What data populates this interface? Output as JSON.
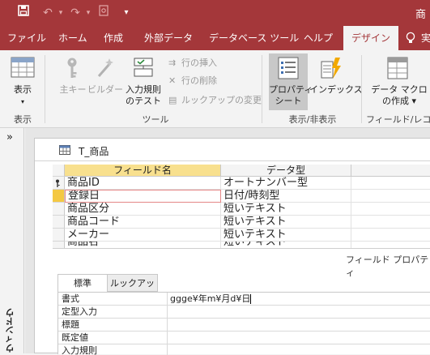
{
  "title_bar": {
    "save_icon": "save-icon",
    "undo_icon": "undo-icon",
    "redo_icon": "redo-icon",
    "print_preview_icon": "print-preview-icon",
    "customize_icon": "customize-qat-icon",
    "title_fragment": "商"
  },
  "tabs": [
    "ファイル",
    "ホーム",
    "作成",
    "外部データ",
    "データベース ツール",
    "ヘルプ",
    "デザイン"
  ],
  "ribbon": {
    "view": {
      "label": "表示",
      "group": "表示"
    },
    "tools": {
      "primary_key": "主キー",
      "builder": "ビルダー",
      "test_rules": [
        "入力規則",
        "のテスト"
      ],
      "insert_rows": "行の挿入",
      "delete_rows": "行の削除",
      "modify_lookups": "ルックアップの変更",
      "group": "ツール"
    },
    "show_hide": {
      "property_sheet": [
        "プロパティ",
        "シート"
      ],
      "indexes": "インデックス",
      "group": "表示/非表示"
    },
    "field_record": {
      "data_macros": [
        "データ マクロ",
        "の作成"
      ],
      "group": "フィールド/レコード"
    }
  },
  "nav_pane": {
    "expand": "»",
    "title": "ウィンドウ"
  },
  "table": {
    "name": "T_商品",
    "columns": [
      "フィールド名",
      "データ型"
    ],
    "rows": [
      {
        "field": "商品ID",
        "type": "オートナンバー型",
        "primary_key": true
      },
      {
        "field": "登録日",
        "type": "日付/時刻型",
        "selected": true
      },
      {
        "field": "商品区分",
        "type": "短いテキスト"
      },
      {
        "field": "商品コード",
        "type": "短いテキスト"
      },
      {
        "field": "メーカー",
        "type": "短いテキスト"
      },
      {
        "field": "商品名",
        "type": "短いテキスト"
      }
    ]
  },
  "field_properties": {
    "heading": "フィールド プロパティ",
    "tabs": [
      "標準",
      "ルックアップ"
    ],
    "rows": [
      {
        "label": "書式",
        "value": "ggge¥年m¥月d¥日"
      },
      {
        "label": "定型入力",
        "value": ""
      },
      {
        "label": "標題",
        "value": ""
      },
      {
        "label": "既定値",
        "value": ""
      },
      {
        "label": "入力規則",
        "value": ""
      }
    ]
  },
  "colors": {
    "accent": "#a4373a",
    "selected_header": "#f8e08e",
    "current_row_marker": "#f4c842",
    "selected_outline": "#e58787"
  }
}
